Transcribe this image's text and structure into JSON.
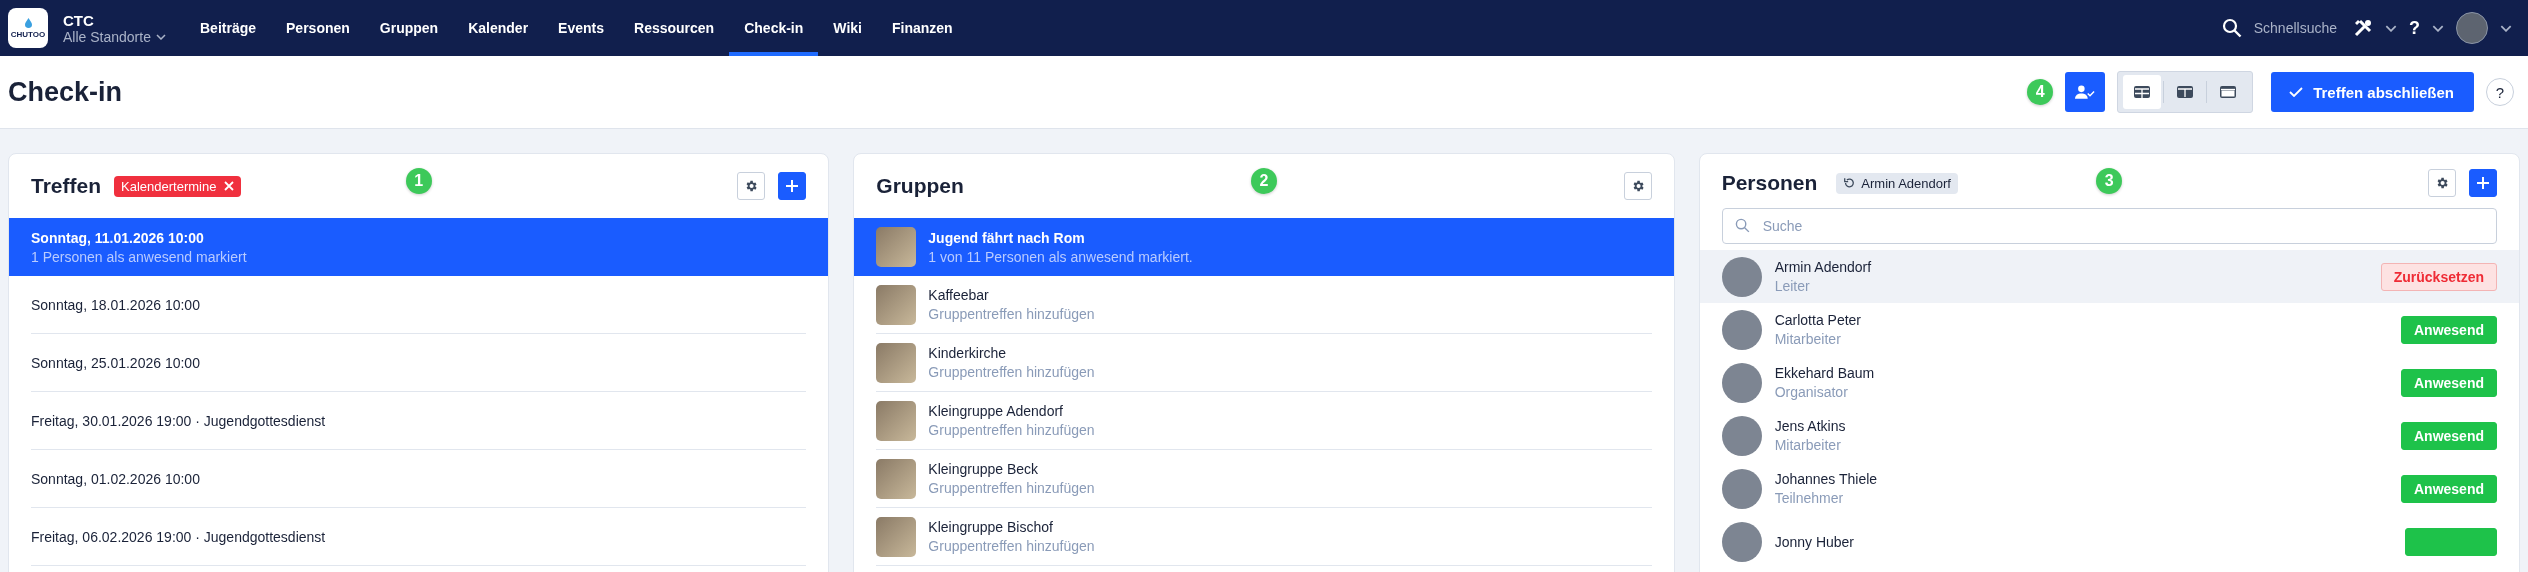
{
  "nav": {
    "logo_text": "CHUTOO",
    "org": "CTC",
    "location": "Alle Standorte",
    "items": [
      {
        "label": "Beiträge",
        "selected": false
      },
      {
        "label": "Personen",
        "selected": false
      },
      {
        "label": "Gruppen",
        "selected": false
      },
      {
        "label": "Kalender",
        "selected": false
      },
      {
        "label": "Events",
        "selected": false
      },
      {
        "label": "Ressourcen",
        "selected": false
      },
      {
        "label": "Check-in",
        "selected": true
      },
      {
        "label": "Wiki",
        "selected": false
      },
      {
        "label": "Finanzen",
        "selected": false
      }
    ],
    "search_label": "Schnellsuche",
    "help": "?"
  },
  "page": {
    "title": "Check-in",
    "annotation": "4",
    "views": [
      {
        "kind": "grid",
        "selected": true
      },
      {
        "kind": "columns",
        "selected": false
      },
      {
        "kind": "single",
        "selected": false
      }
    ],
    "finish_button": "Treffen abschließen",
    "help": "?"
  },
  "meetings": {
    "title": "Treffen",
    "filter_tag": "Kalendertermine",
    "annotation": "1",
    "items": [
      {
        "title": "Sonntag, 11.01.2026 10:00",
        "subtitle": "1 Personen als anwesend markiert",
        "selected": true
      },
      {
        "title": "Sonntag, 18.01.2026 10:00",
        "selected": false
      },
      {
        "title": "Sonntag, 25.01.2026 10:00",
        "selected": false
      },
      {
        "title": "Freitag, 30.01.2026 19:00 · Jugendgottesdienst",
        "selected": false
      },
      {
        "title": "Sonntag, 01.02.2026 10:00",
        "selected": false
      },
      {
        "title": "Freitag, 06.02.2026 19:00 · Jugendgottesdienst",
        "selected": false
      }
    ]
  },
  "groups": {
    "title": "Gruppen",
    "annotation": "2",
    "items": [
      {
        "name": "Jugend fährt nach Rom",
        "subtitle": "1 von 11 Personen als anwesend markiert.",
        "selected": true
      },
      {
        "name": "Kaffeebar",
        "subtitle": "Gruppentreffen hinzufügen",
        "selected": false
      },
      {
        "name": "Kinderkirche",
        "subtitle": "Gruppentreffen hinzufügen",
        "selected": false
      },
      {
        "name": "Kleingruppe Adendorf",
        "subtitle": "Gruppentreffen hinzufügen",
        "selected": false
      },
      {
        "name": "Kleingruppe Beck",
        "subtitle": "Gruppentreffen hinzufügen",
        "selected": false
      },
      {
        "name": "Kleingruppe Bischof",
        "subtitle": "Gruppentreffen hinzufügen",
        "selected": false
      }
    ]
  },
  "persons": {
    "title": "Personen",
    "undo_tag": "Armin Adendorf",
    "annotation": "3",
    "search": {
      "placeholder": "Suche"
    },
    "items": [
      {
        "name": "Armin Adendorf",
        "role": "Leiter",
        "present": true,
        "action": "Zurücksetzen"
      },
      {
        "name": "Carlotta Peter",
        "role": "Mitarbeiter",
        "present": false,
        "action": "Anwesend"
      },
      {
        "name": "Ekkehard Baum",
        "role": "Organisator",
        "present": false,
        "action": "Anwesend"
      },
      {
        "name": "Jens Atkins",
        "role": "Mitarbeiter",
        "present": false,
        "action": "Anwesend"
      },
      {
        "name": "Johannes Thiele",
        "role": "Teilnehmer",
        "present": false,
        "action": "Anwesend"
      },
      {
        "name": "Jonny Huber",
        "present": false
      }
    ]
  }
}
